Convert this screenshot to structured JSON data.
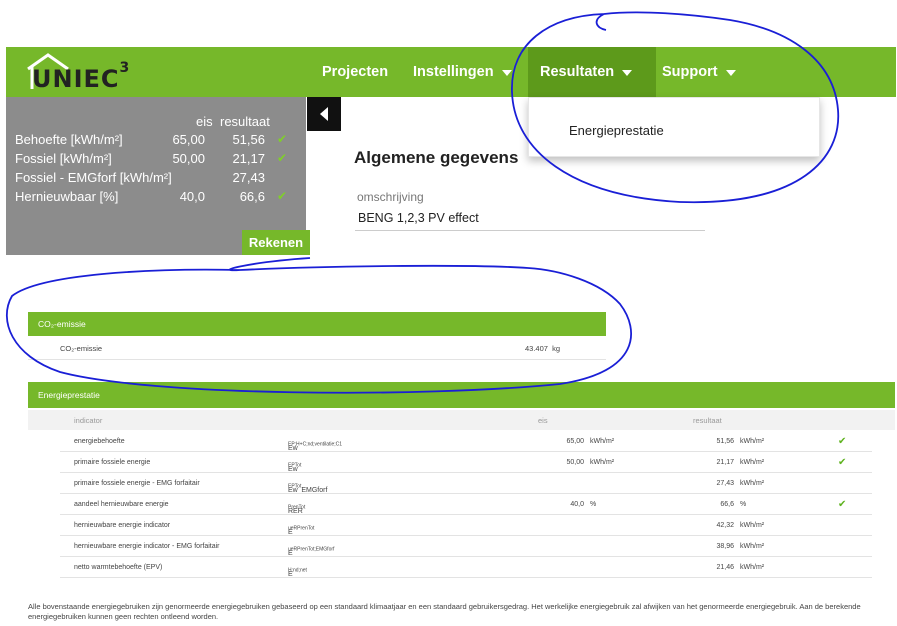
{
  "app": {
    "logo": "UNIEC",
    "logo_sup": "3"
  },
  "nav": {
    "projecten": "Projecten",
    "instellingen": "Instellingen",
    "resultaten": "Resultaten",
    "support": "Support",
    "dropdown_item": "Energieprestatie"
  },
  "summary": {
    "col_eis": "eis",
    "col_resultaat": "resultaat",
    "rows": [
      {
        "label": "Behoefte [kWh/m²]",
        "eis": "65,00",
        "resultaat": "51,56",
        "check": "✔"
      },
      {
        "label": "Fossiel [kWh/m²]",
        "eis": "50,00",
        "resultaat": "21,17",
        "check": "✔"
      },
      {
        "label": "Fossiel - EMGforf [kWh/m²]",
        "eis": "",
        "resultaat": "27,43",
        "check": ""
      },
      {
        "label": "Hernieuwbaar [%]",
        "eis": "40,0",
        "resultaat": "66,6",
        "check": "✔"
      }
    ],
    "button": "Rekenen"
  },
  "general": {
    "title": "Algemene gegevens",
    "label": "omschrijving",
    "value": "BENG 1,2,3 PV effect"
  },
  "co2": {
    "title": "CO₂-emissie",
    "row_label": "CO₂-emissie",
    "row_value": "43.407",
    "row_unit": "kg"
  },
  "energie": {
    "title": "Energieprestatie",
    "col_indicator": "indicator",
    "col_eis": "eis",
    "col_resultaat": "resultaat",
    "rows": [
      {
        "indicator": "energiebehoefte",
        "symbol": "Ew",
        "symbol_sub": "EP;H+C;nd;ventilatie;C1",
        "eis": "65,00",
        "eis_unit": "kWh/m²",
        "resultaat": "51,56",
        "res_unit": "kWh/m²",
        "check": "✔"
      },
      {
        "indicator": "primaire fossiele energie",
        "symbol": "Ew",
        "symbol_sub": "EPTot",
        "eis": "50,00",
        "eis_unit": "kWh/m²",
        "resultaat": "21,17",
        "res_unit": "kWh/m²",
        "check": "✔"
      },
      {
        "indicator": "primaire fossiele energie - EMG forfaitair",
        "symbol": "Ew",
        "symbol_sub": "EPTot",
        "symbol_tail": "EMGforf",
        "eis": "",
        "eis_unit": "",
        "resultaat": "27,43",
        "res_unit": "kWh/m²",
        "check": ""
      },
      {
        "indicator": "aandeel hernieuwbare energie",
        "symbol": "RER",
        "symbol_sub": "PrenTot",
        "eis": "40,0",
        "eis_unit": "%",
        "resultaat": "66,6",
        "res_unit": "%",
        "check": "✔"
      },
      {
        "indicator": "hernieuwbare energie indicator",
        "symbol": "E",
        "symbol_sub": "ueRPrenTot",
        "eis": "",
        "eis_unit": "",
        "resultaat": "42,32",
        "res_unit": "kWh/m²",
        "check": ""
      },
      {
        "indicator": "hernieuwbare energie indicator - EMG forfaitair",
        "symbol": "E",
        "symbol_sub": "ueRPrenTot;EMGforf",
        "eis": "",
        "eis_unit": "",
        "resultaat": "38,96",
        "res_unit": "kWh/m²",
        "check": ""
      },
      {
        "indicator": "netto warmtebehoefte (EPV)",
        "symbol": "E",
        "symbol_sub": "H;nd;net",
        "eis": "",
        "eis_unit": "",
        "resultaat": "21,46",
        "res_unit": "kWh/m²",
        "check": ""
      }
    ]
  },
  "footnote": "Alle bovenstaande energiegebruiken zijn genormeerde energiegebruiken gebaseerd op een standaard klimaatjaar en een standaard gebruikersgedrag. Het werkelijke energiegebruik zal afwijken van het genormeerde energiegebruik. Aan de berekende energiegebruiken kunnen geen rechten ontleend worden.",
  "colors": {
    "brand_green": "#76b82a",
    "nav_active": "#5d9a1b",
    "panel_grey": "#8c8c8c",
    "annotation_blue": "#1a1fd6"
  }
}
